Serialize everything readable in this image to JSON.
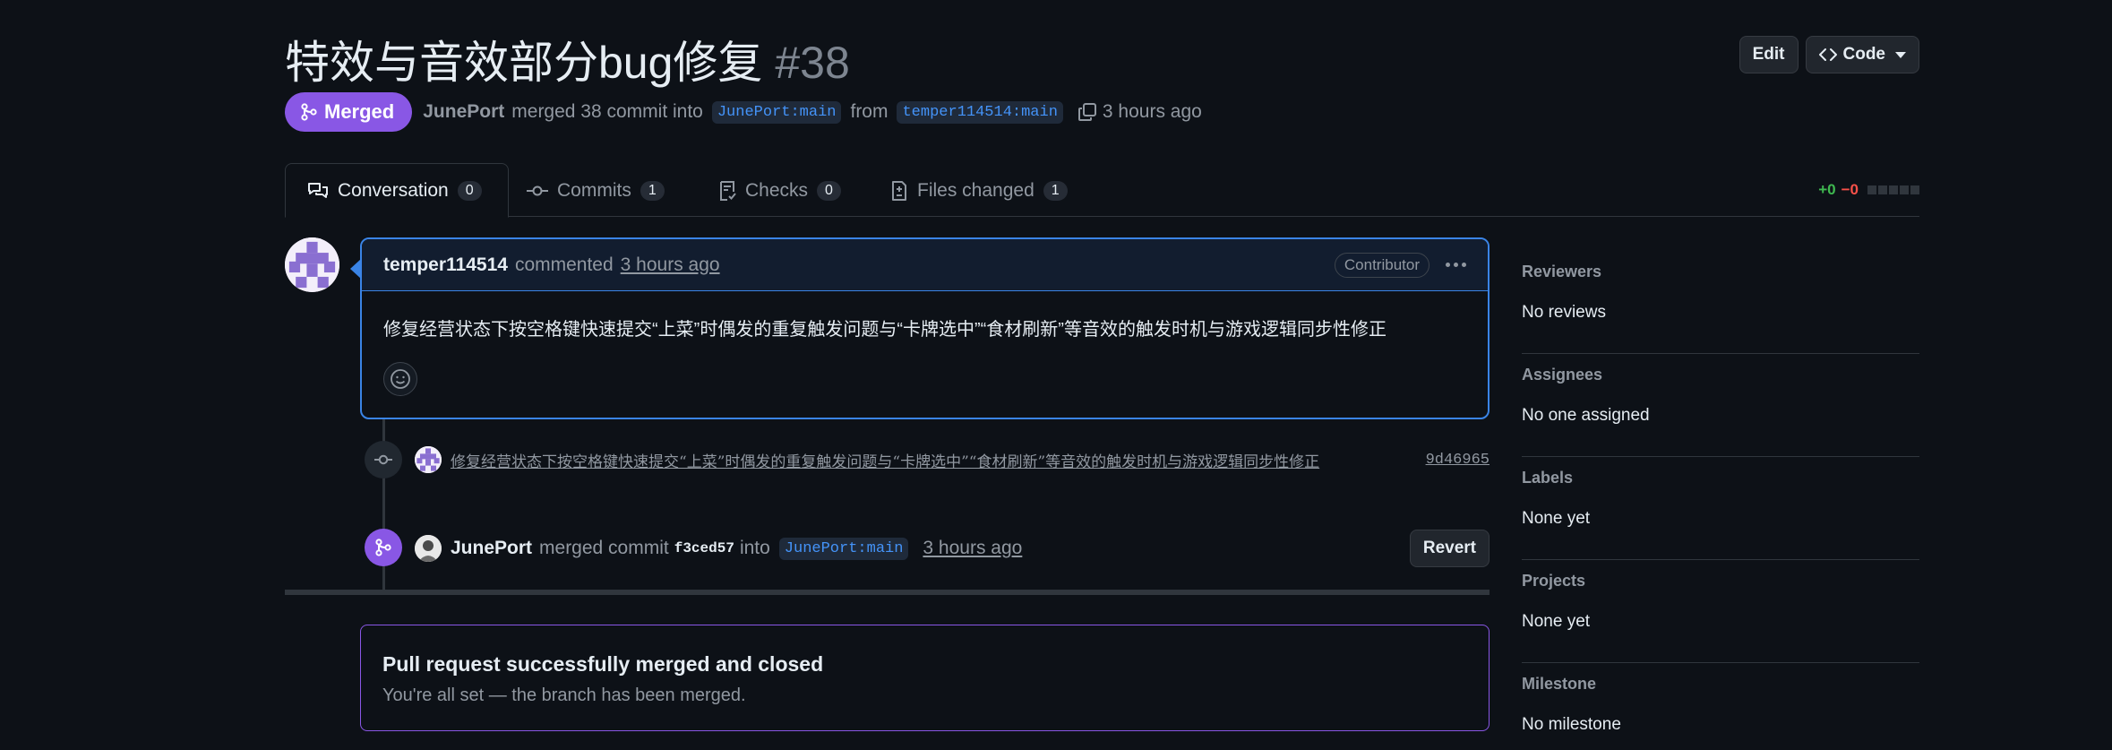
{
  "header": {
    "title": "特效与音效部分bug修复",
    "number": "#38",
    "edit_label": "Edit",
    "code_label": "Code"
  },
  "meta": {
    "status": "Merged",
    "author": "JunePort",
    "text_merged": "merged 38 commit into",
    "base_branch": "JunePort:main",
    "text_from": "from",
    "head_branch": "temper114514:main",
    "time": "3 hours ago"
  },
  "tabs": [
    {
      "label": "Conversation",
      "count": "0",
      "icon": "conversation-icon"
    },
    {
      "label": "Commits",
      "count": "1",
      "icon": "commit-icon"
    },
    {
      "label": "Checks",
      "count": "0",
      "icon": "checklist-icon"
    },
    {
      "label": "Files changed",
      "count": "1",
      "icon": "file-diff-icon"
    }
  ],
  "diffstat": {
    "additions": "+0",
    "deletions": "−0"
  },
  "comment": {
    "author": "temper114514",
    "action": "commented",
    "time": "3 hours ago",
    "role": "Contributor",
    "body": "修复经营状态下按空格键快速提交“上菜”时偶发的重复触发问题与“卡牌选中”“食材刷新”等音效的触发时机与游戏逻辑同步性修正"
  },
  "commit": {
    "message": "修复经营状态下按空格键快速提交“上菜”时偶发的重复触发问题与“卡牌选中”“食材刷新”等音效的触发时机与游戏逻辑同步性修正",
    "sha": "9d46965"
  },
  "merge_event": {
    "author": "JunePort",
    "text_merged": "merged commit",
    "sha": "f3ced57",
    "text_into": "into",
    "branch": "JunePort:main",
    "time": "3 hours ago",
    "revert_label": "Revert"
  },
  "merged_box": {
    "title": "Pull request successfully merged and closed",
    "subtitle": "You're all set — the branch has been merged."
  },
  "sidebar": [
    {
      "title": "Reviewers",
      "value": "No reviews"
    },
    {
      "title": "Assignees",
      "value": "No one assigned"
    },
    {
      "title": "Labels",
      "value": "None yet"
    },
    {
      "title": "Projects",
      "value": "None yet"
    },
    {
      "title": "Milestone",
      "value": "No milestone"
    }
  ],
  "colors": {
    "background": "#0d1117",
    "merged_purple": "#8957e5",
    "accent_blue": "#4493f8",
    "add_green": "#3fb950",
    "delete_red": "#f85149"
  }
}
